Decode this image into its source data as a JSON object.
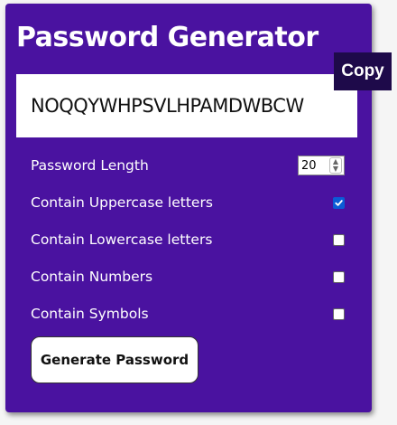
{
  "app": {
    "title": "Password Generator",
    "copy_label": "Copy"
  },
  "result": {
    "password": "NOQQYWHPSVLHPAMDWBCW"
  },
  "settings": {
    "length": {
      "label": "Password Length",
      "value": "20"
    },
    "uppercase": {
      "label": "Contain Uppercase letters",
      "checked": true
    },
    "lowercase": {
      "label": "Contain Lowercase letters",
      "checked": false
    },
    "numbers": {
      "label": "Contain Numbers",
      "checked": false
    },
    "symbols": {
      "label": "Contain Symbols",
      "checked": false
    }
  },
  "actions": {
    "generate_label": "Generate Password"
  },
  "colors": {
    "panel": "#4a12a0",
    "copy_bg": "#1e0a4a",
    "checkbox_checked": "#0b5cd6"
  }
}
